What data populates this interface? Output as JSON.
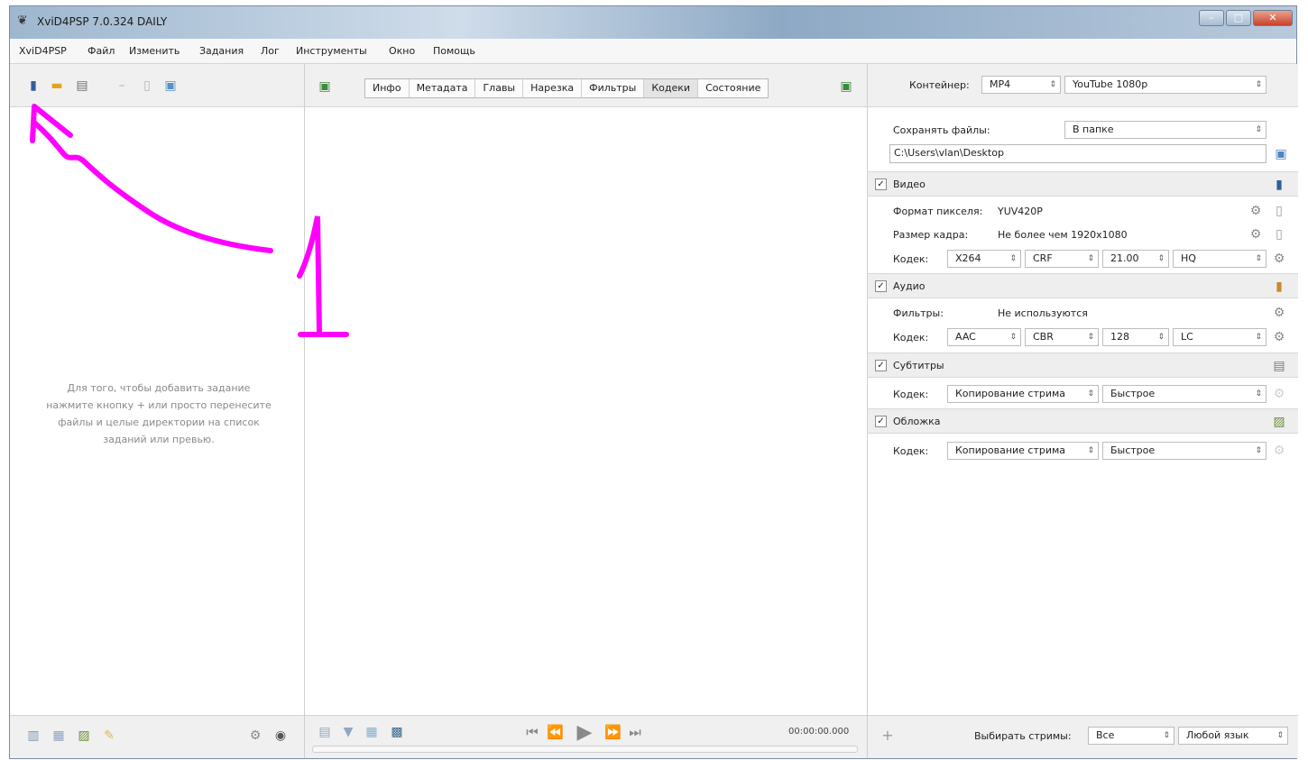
{
  "window": {
    "title": "XviD4PSP 7.0.324 DAILY"
  },
  "menu": [
    "XviD4PSP",
    "Файл",
    "Изменить",
    "Задания",
    "Лог",
    "Инструменты",
    "Окно",
    "Помощь"
  ],
  "left": {
    "hint": [
      "Для того, чтобы добавить задание",
      "нажмите кнопку + или просто перенесите",
      "файлы и целые директории на список",
      "заданий или превью."
    ]
  },
  "tabs": [
    "Инфо",
    "Метадата",
    "Главы",
    "Нарезка",
    "Фильтры",
    "Кодеки",
    "Состояние"
  ],
  "active_tab": "Кодеки",
  "player": {
    "time": "00:00:00.000"
  },
  "right": {
    "container_label": "Контейнер:",
    "container_value": "MP4",
    "preset_value": "YouTube 1080p",
    "save_label": "Сохранять файлы:",
    "save_value": "В папке",
    "path": "C:\\Users\\vlan\\Desktop",
    "video": {
      "title": "Видео",
      "pixel_label": "Формат пикселя:",
      "pixel_value": "YUV420P",
      "frame_label": "Размер кадра:",
      "frame_value": "Не более чем 1920x1080",
      "codec_label": "Кодек:",
      "codec": "X264",
      "mode": "CRF",
      "value": "21.00",
      "preset": "HQ"
    },
    "audio": {
      "title": "Аудио",
      "filters_label": "Фильтры:",
      "filters_value": "Не используются",
      "codec_label": "Кодек:",
      "codec": "AAC",
      "mode": "CBR",
      "value": "128",
      "profile": "LC"
    },
    "subtitles": {
      "title": "Субтитры",
      "codec_label": "Кодек:",
      "codec": "Копирование стрима",
      "speed": "Быстрое"
    },
    "cover": {
      "title": "Обложка",
      "codec_label": "Кодек:",
      "codec": "Копирование стрима",
      "speed": "Быстрое"
    },
    "streams_label": "Выбирать стримы:",
    "streams_value": "Все",
    "language_value": "Любой язык"
  },
  "annotation": {
    "number": "1",
    "color": "#ff00ff"
  }
}
